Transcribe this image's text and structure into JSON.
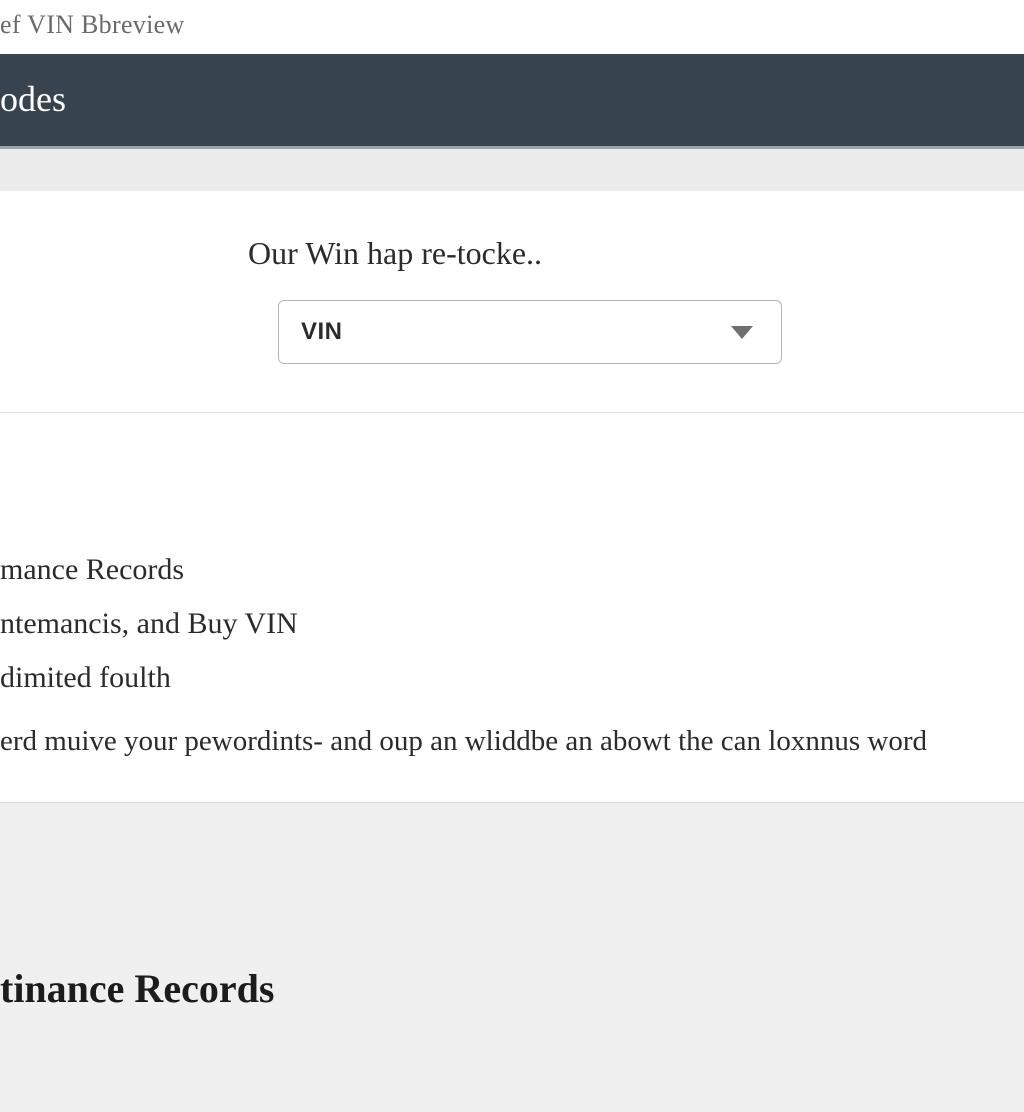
{
  "browser": {
    "title": "ef VIN Bbreview"
  },
  "header": {
    "title": "odes"
  },
  "card": {
    "prompt": "Our Win hap re-tocke..",
    "dropdown": {
      "selected": "VIN"
    }
  },
  "content": {
    "line1": "mance Records",
    "line2": "ntemancis, and Buy VIN",
    "line3": "dimited foulth",
    "line4": "erd muive your pewordints- and oup an wliddbe an abowt the can loxnnus word"
  },
  "lower": {
    "heading": "tinance Records"
  }
}
